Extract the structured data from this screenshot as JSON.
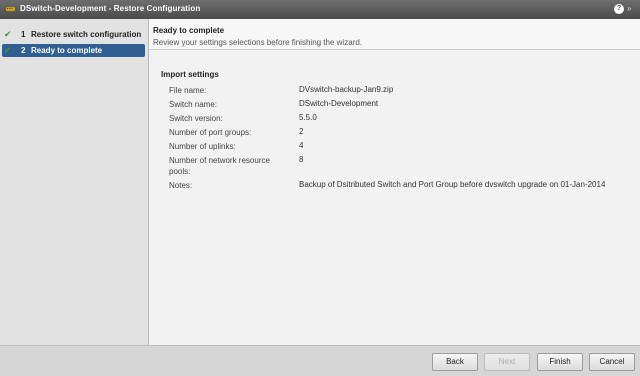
{
  "window": {
    "title": "DSwitch-Development - Restore Configuration",
    "help_glyph": "?"
  },
  "steps": [
    {
      "number": "1",
      "label": "Restore switch configuration",
      "completed": true,
      "active": false
    },
    {
      "number": "2",
      "label": "Ready to complete",
      "completed": true,
      "active": true
    }
  ],
  "header": {
    "title": "Ready to complete",
    "subtitle": "Review your settings selections before finishing the wizard."
  },
  "import_settings": {
    "title": "Import settings",
    "rows": [
      {
        "label": "File name:",
        "value": "DVswitch-backup-Jan9.zip"
      },
      {
        "label": "Switch name:",
        "value": "DSwitch-Development"
      },
      {
        "label": "Switch version:",
        "value": "5.5.0"
      },
      {
        "label": "Number of port groups:",
        "value": "2"
      },
      {
        "label": "Number of uplinks:",
        "value": "4"
      },
      {
        "label": "Number of network resource pools:",
        "value": "8"
      },
      {
        "label": "Notes:",
        "value": "Backup of Dsitributed Switch and Port Group before dvswitch upgrade on 01-Jan-2014"
      }
    ]
  },
  "buttons": {
    "back": "Back",
    "next": "Next",
    "finish": "Finish",
    "cancel": "Cancel"
  },
  "colors": {
    "active_step": "#2f5f93",
    "check": "#3d9a28",
    "titlebar": "#4a4a4a"
  }
}
